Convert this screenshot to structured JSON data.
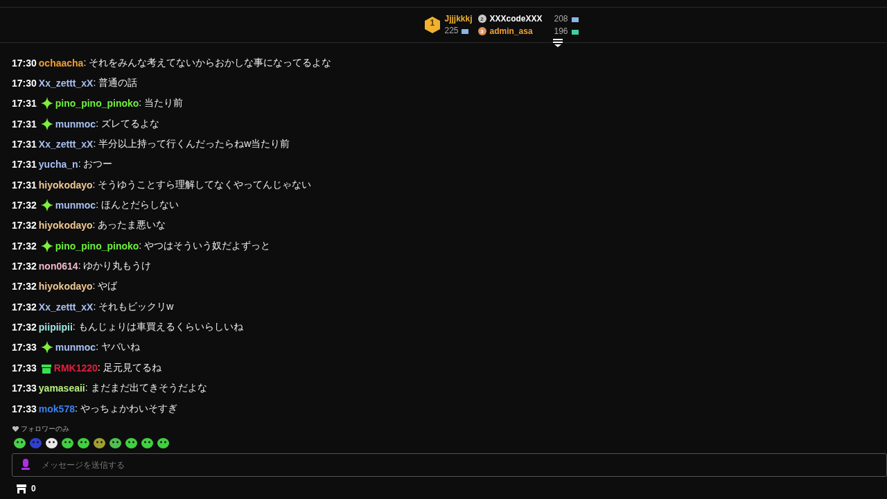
{
  "leaderboard": [
    {
      "rank": "1",
      "name": "Jjjjkkkj",
      "count": "225",
      "color": "#f0b030"
    },
    {
      "rank": "2",
      "name": "XXXcodeXXX",
      "count": "208",
      "color": "#ffffff"
    },
    {
      "rank": "3",
      "name": "admin_asa",
      "count": "196",
      "color": "#f0a030"
    }
  ],
  "messages": [
    {
      "time": "17:30",
      "kind": "plain",
      "user": "ochaacha",
      "color": "#f0a030",
      "text": ": それをみんな考えてないからおかしな事になってるよな"
    },
    {
      "time": "17:30",
      "kind": "plain",
      "user": "Xx_zettt_xX",
      "color": "#a8c0f0",
      "text": ": 普通の話"
    },
    {
      "time": "17:31",
      "kind": "sparkle",
      "user": "pino_pino_pinoko",
      "color": "#6ef03a",
      "text": ": 当たり前"
    },
    {
      "time": "17:31",
      "kind": "sparkle",
      "user": "munmoc",
      "color": "#a8c0f0",
      "text": ": ズレてるよな"
    },
    {
      "time": "17:31",
      "kind": "plain",
      "user": "Xx_zettt_xX",
      "color": "#a8c0f0",
      "text": ": 半分以上持って行くんだったらねw当たり前"
    },
    {
      "time": "17:31",
      "kind": "plain",
      "user": "yucha_n",
      "color": "#a8c0f0",
      "text": ": おつー"
    },
    {
      "time": "17:31",
      "kind": "plain",
      "user": "hiyokodayo",
      "color": "#f0c890",
      "text": ": そうゆうことすら理解してなくやってんじゃない"
    },
    {
      "time": "17:32",
      "kind": "sparkle",
      "user": "munmoc",
      "color": "#a8c0f0",
      "text": ": ほんとだらしない"
    },
    {
      "time": "17:32",
      "kind": "plain",
      "user": "hiyokodayo",
      "color": "#f0c890",
      "text": ": あったま悪いな"
    },
    {
      "time": "17:32",
      "kind": "sparkle",
      "user": "pino_pino_pinoko",
      "color": "#6ef03a",
      "text": ": やつはそういう奴だよずっと"
    },
    {
      "time": "17:32",
      "kind": "plain",
      "user": "non0614",
      "color": "#f0b8c8",
      "text": ": ゆかり丸もうけ"
    },
    {
      "time": "17:32",
      "kind": "plain",
      "user": "hiyokodayo",
      "color": "#f0c890",
      "text": ": やば"
    },
    {
      "time": "17:32",
      "kind": "plain",
      "user": "Xx_zettt_xX",
      "color": "#a8c0f0",
      "text": ": それもビックリw"
    },
    {
      "time": "17:32",
      "kind": "plain",
      "user": "piipiipii",
      "color": "#a0e8e0",
      "text": ": もんじょりは車買えるくらいらしいね"
    },
    {
      "time": "17:33",
      "kind": "sparkle",
      "user": "munmoc",
      "color": "#a8c0f0",
      "text": ": ヤバいね"
    },
    {
      "time": "17:33",
      "kind": "gift",
      "user": "RMK1220",
      "color": "#e0203c",
      "text": ": 足元見てるね"
    },
    {
      "time": "17:33",
      "kind": "plain",
      "user": "yamaseaii",
      "color": "#b8f080",
      "text": ": まだまだ出てきそうだよな"
    },
    {
      "time": "17:33",
      "kind": "plain",
      "user": "mok578",
      "color": "#3a80f0",
      "text": ": やっちょかわいそすぎ"
    }
  ],
  "chat_mode": "フォロワーのみ",
  "input": {
    "placeholder": "メッセージを送信する"
  },
  "points": "0"
}
